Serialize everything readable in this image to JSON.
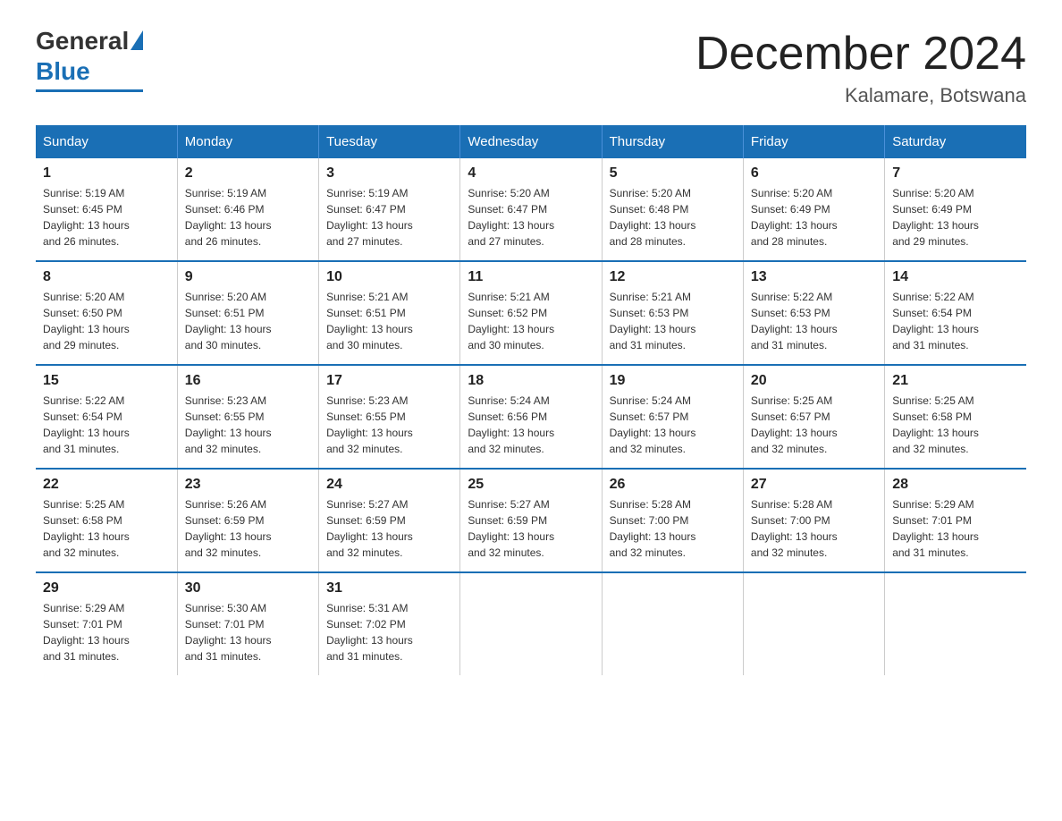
{
  "header": {
    "logo_general": "General",
    "logo_blue": "Blue",
    "month_title": "December 2024",
    "location": "Kalamare, Botswana"
  },
  "weekdays": [
    "Sunday",
    "Monday",
    "Tuesday",
    "Wednesday",
    "Thursday",
    "Friday",
    "Saturday"
  ],
  "weeks": [
    [
      {
        "day": "1",
        "sunrise": "5:19 AM",
        "sunset": "6:45 PM",
        "daylight": "13 hours and 26 minutes."
      },
      {
        "day": "2",
        "sunrise": "5:19 AM",
        "sunset": "6:46 PM",
        "daylight": "13 hours and 26 minutes."
      },
      {
        "day": "3",
        "sunrise": "5:19 AM",
        "sunset": "6:47 PM",
        "daylight": "13 hours and 27 minutes."
      },
      {
        "day": "4",
        "sunrise": "5:20 AM",
        "sunset": "6:47 PM",
        "daylight": "13 hours and 27 minutes."
      },
      {
        "day": "5",
        "sunrise": "5:20 AM",
        "sunset": "6:48 PM",
        "daylight": "13 hours and 28 minutes."
      },
      {
        "day": "6",
        "sunrise": "5:20 AM",
        "sunset": "6:49 PM",
        "daylight": "13 hours and 28 minutes."
      },
      {
        "day": "7",
        "sunrise": "5:20 AM",
        "sunset": "6:49 PM",
        "daylight": "13 hours and 29 minutes."
      }
    ],
    [
      {
        "day": "8",
        "sunrise": "5:20 AM",
        "sunset": "6:50 PM",
        "daylight": "13 hours and 29 minutes."
      },
      {
        "day": "9",
        "sunrise": "5:20 AM",
        "sunset": "6:51 PM",
        "daylight": "13 hours and 30 minutes."
      },
      {
        "day": "10",
        "sunrise": "5:21 AM",
        "sunset": "6:51 PM",
        "daylight": "13 hours and 30 minutes."
      },
      {
        "day": "11",
        "sunrise": "5:21 AM",
        "sunset": "6:52 PM",
        "daylight": "13 hours and 30 minutes."
      },
      {
        "day": "12",
        "sunrise": "5:21 AM",
        "sunset": "6:53 PM",
        "daylight": "13 hours and 31 minutes."
      },
      {
        "day": "13",
        "sunrise": "5:22 AM",
        "sunset": "6:53 PM",
        "daylight": "13 hours and 31 minutes."
      },
      {
        "day": "14",
        "sunrise": "5:22 AM",
        "sunset": "6:54 PM",
        "daylight": "13 hours and 31 minutes."
      }
    ],
    [
      {
        "day": "15",
        "sunrise": "5:22 AM",
        "sunset": "6:54 PM",
        "daylight": "13 hours and 31 minutes."
      },
      {
        "day": "16",
        "sunrise": "5:23 AM",
        "sunset": "6:55 PM",
        "daylight": "13 hours and 32 minutes."
      },
      {
        "day": "17",
        "sunrise": "5:23 AM",
        "sunset": "6:55 PM",
        "daylight": "13 hours and 32 minutes."
      },
      {
        "day": "18",
        "sunrise": "5:24 AM",
        "sunset": "6:56 PM",
        "daylight": "13 hours and 32 minutes."
      },
      {
        "day": "19",
        "sunrise": "5:24 AM",
        "sunset": "6:57 PM",
        "daylight": "13 hours and 32 minutes."
      },
      {
        "day": "20",
        "sunrise": "5:25 AM",
        "sunset": "6:57 PM",
        "daylight": "13 hours and 32 minutes."
      },
      {
        "day": "21",
        "sunrise": "5:25 AM",
        "sunset": "6:58 PM",
        "daylight": "13 hours and 32 minutes."
      }
    ],
    [
      {
        "day": "22",
        "sunrise": "5:25 AM",
        "sunset": "6:58 PM",
        "daylight": "13 hours and 32 minutes."
      },
      {
        "day": "23",
        "sunrise": "5:26 AM",
        "sunset": "6:59 PM",
        "daylight": "13 hours and 32 minutes."
      },
      {
        "day": "24",
        "sunrise": "5:27 AM",
        "sunset": "6:59 PM",
        "daylight": "13 hours and 32 minutes."
      },
      {
        "day": "25",
        "sunrise": "5:27 AM",
        "sunset": "6:59 PM",
        "daylight": "13 hours and 32 minutes."
      },
      {
        "day": "26",
        "sunrise": "5:28 AM",
        "sunset": "7:00 PM",
        "daylight": "13 hours and 32 minutes."
      },
      {
        "day": "27",
        "sunrise": "5:28 AM",
        "sunset": "7:00 PM",
        "daylight": "13 hours and 32 minutes."
      },
      {
        "day": "28",
        "sunrise": "5:29 AM",
        "sunset": "7:01 PM",
        "daylight": "13 hours and 31 minutes."
      }
    ],
    [
      {
        "day": "29",
        "sunrise": "5:29 AM",
        "sunset": "7:01 PM",
        "daylight": "13 hours and 31 minutes."
      },
      {
        "day": "30",
        "sunrise": "5:30 AM",
        "sunset": "7:01 PM",
        "daylight": "13 hours and 31 minutes."
      },
      {
        "day": "31",
        "sunrise": "5:31 AM",
        "sunset": "7:02 PM",
        "daylight": "13 hours and 31 minutes."
      },
      null,
      null,
      null,
      null
    ]
  ],
  "labels": {
    "sunrise": "Sunrise:",
    "sunset": "Sunset:",
    "daylight": "Daylight:"
  }
}
